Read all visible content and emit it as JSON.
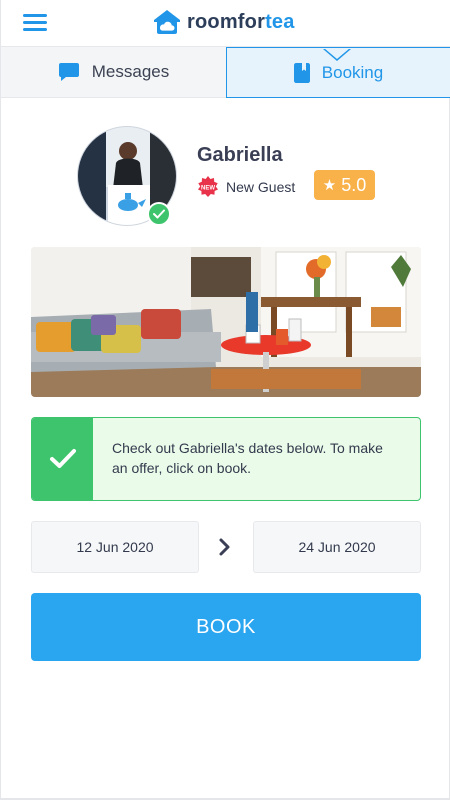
{
  "header": {
    "logo_text_a": "roomfor",
    "logo_text_b": "tea",
    "menu_icon": "hamburger-menu-icon",
    "logo_icon": "house-cloud-icon"
  },
  "tabs": [
    {
      "label": "Messages",
      "icon": "chat-bubble-icon",
      "active": false
    },
    {
      "label": "Booking",
      "icon": "bookmark-book-icon",
      "active": true
    }
  ],
  "guest": {
    "name": "Gabriella",
    "type": "New Guest",
    "new_badge_text": "NEW",
    "rating": "5.0",
    "verified": true
  },
  "info": {
    "text": "Check out Gabriella's dates below. To make an offer, click on book.",
    "icon": "checkmark-icon"
  },
  "dates": {
    "start": "12 Jun 2020",
    "end": "24 Jun 2020"
  },
  "actions": {
    "book_label": "BOOK"
  },
  "colors": {
    "brand_blue": "#2196e8",
    "button_blue": "#2aa5f0",
    "success_green": "#3ec46d",
    "rating_orange": "#f9b14a",
    "new_badge_red": "#e8334a"
  }
}
